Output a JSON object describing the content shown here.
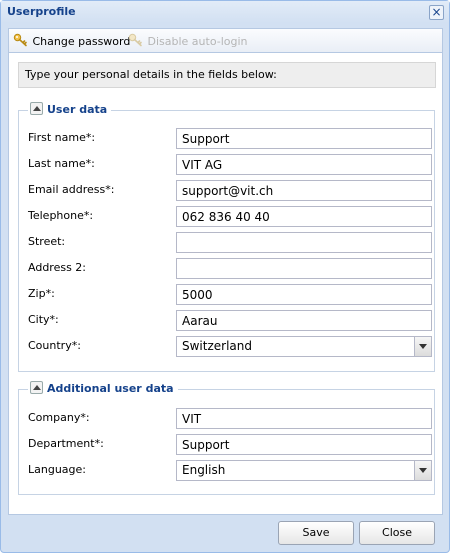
{
  "window": {
    "title": "Userprofile",
    "close_symbol": "×"
  },
  "toolbar": {
    "change_password": "Change password",
    "disable_autologin": "Disable auto-login"
  },
  "intro_text": "Type your personal details in the fields below:",
  "user_data": {
    "legend": "User data",
    "fields": [
      {
        "label": "First name*:",
        "value": "Support"
      },
      {
        "label": "Last name*:",
        "value": "VIT AG"
      },
      {
        "label": "Email address*:",
        "value": "support@vit.ch"
      },
      {
        "label": "Telephone*:",
        "value": "062 836 40 40"
      },
      {
        "label": "Street:",
        "value": ""
      },
      {
        "label": "Address 2:",
        "value": ""
      },
      {
        "label": "Zip*:",
        "value": "5000"
      },
      {
        "label": "City*:",
        "value": "Aarau"
      },
      {
        "label": "Country*:",
        "value": "Switzerland"
      }
    ]
  },
  "additional_data": {
    "legend": "Additional user data",
    "fields": [
      {
        "label": "Company*:",
        "value": "VIT"
      },
      {
        "label": "Department*:",
        "value": "Support"
      },
      {
        "label": "Language:",
        "value": "English"
      }
    ]
  },
  "buttons": {
    "save": "Save",
    "close": "Close"
  },
  "icons": {
    "change_password": "key-icon",
    "disable_autologin": "key-disabled-icon"
  },
  "colors": {
    "title": "#15428b",
    "window_bg": "#d2e0f2",
    "border": "#99bbe8"
  }
}
